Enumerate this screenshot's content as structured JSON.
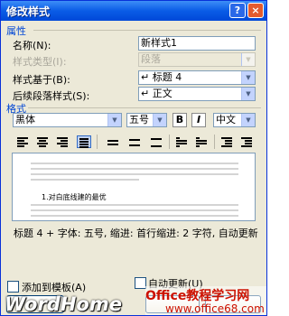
{
  "window": {
    "title": "修改样式",
    "help_glyph": "?",
    "close_glyph": "×"
  },
  "properties": {
    "group_label": "属性",
    "name_label": "名称(N):",
    "name_value": "新样式1",
    "type_label": "样式类型(I):",
    "type_value": "段落",
    "based_on_label": "样式基于(B):",
    "based_on_value": "↵ 标题 4",
    "following_label": "后续段落样式(S):",
    "following_value": "↵ 正文"
  },
  "format": {
    "group_label": "格式",
    "font": "黑体",
    "size": "五号",
    "bold": "B",
    "italic": "I",
    "script": "中文"
  },
  "preview": {
    "sample_text": "1.对白底线建的最优"
  },
  "description": "标题 4 + 字体: 五号, 缩进: 首行缩进:  2 字符, 自动更新",
  "bottom": {
    "add_template_label": "添加到模板(A)",
    "auto_update_label": "自动更新(U)"
  },
  "watermark": {
    "left": "WordHome",
    "right_top": "Office教程学习网",
    "right_bottom": "www.office68.com"
  },
  "colors": {
    "title_bar": "#0a5ce6",
    "group_label": "#0046d5",
    "dialog_bg": "#ece9d8",
    "watermark_red": "#cc1100"
  }
}
